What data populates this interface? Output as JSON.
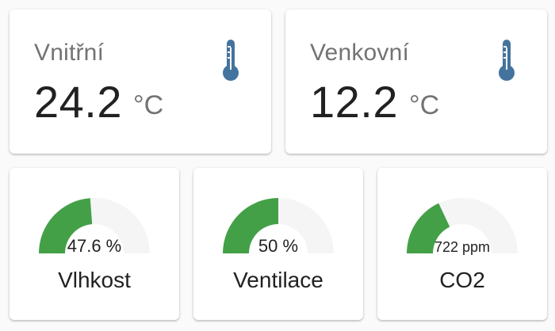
{
  "colors": {
    "gauge_fill": "#43a047",
    "gauge_track": "#f5f5f5",
    "thermometer_icon": "#44739e"
  },
  "sensors": [
    {
      "name": "Vnitřní",
      "value": "24.2",
      "unit": "°C",
      "icon": "thermometer-icon"
    },
    {
      "name": "Venkovní",
      "value": "12.2",
      "unit": "°C",
      "icon": "thermometer-icon"
    }
  ],
  "gauges": [
    {
      "name": "Vlhkost",
      "value_text": "47.6 %",
      "level_percent": 47.6
    },
    {
      "name": "Ventilace",
      "value_text": "50 %",
      "level_percent": 50
    },
    {
      "name": "CO2",
      "value_text": "722 ppm",
      "level_percent": 36
    }
  ]
}
